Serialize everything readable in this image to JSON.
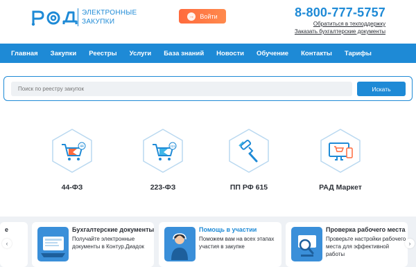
{
  "header": {
    "logo_text_line1": "ЭЛЕКТРОННЫЕ",
    "logo_text_line2": "ЗАКУПКИ",
    "login_label": "Войти",
    "phone": "8-800-777-5757",
    "support_link": "Обратиться в техподдержку",
    "docs_link": "Заказать бухгалтерские документы"
  },
  "nav": {
    "items": [
      "Главная",
      "Закупки",
      "Реестры",
      "Услуги",
      "База знаний",
      "Новости",
      "Обучение",
      "Контакты",
      "Тарифы"
    ]
  },
  "search": {
    "placeholder": "Поиск по реестру закупок",
    "button": "Искать"
  },
  "categories": [
    {
      "label": "44-ФЗ",
      "badge": "44"
    },
    {
      "label": "223-ФЗ",
      "badge": "223"
    },
    {
      "label": "ПП РФ 615"
    },
    {
      "label": "РАД Маркет"
    }
  ],
  "cards": [
    {
      "title": "Бухгалтерские документы",
      "desc": "Получайте электронные документы в Контур.Диадок"
    },
    {
      "title": "Помощь в участии",
      "desc": "Поможем вам на всех этапах участия в закупке"
    },
    {
      "title": "Проверка рабочего места",
      "desc": "Проверьте настройки рабочего места для эффективной работы"
    }
  ],
  "colors": {
    "brand": "#1e8ad6",
    "login": "#ff6a3d"
  }
}
